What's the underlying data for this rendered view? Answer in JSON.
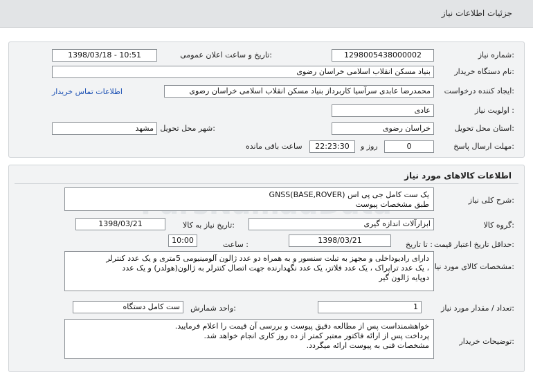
{
  "header": {
    "title": "جزئیات اطلاعات نیاز"
  },
  "need_info": {
    "need_number_label": "شماره نیاز:",
    "need_number": "1298005438000002",
    "announce_label": "تاریخ و ساعت اعلان عمومی:",
    "announce_value": "1398/03/18 - 10:51",
    "buyer_label": "نام دستگاه خریدار:",
    "buyer_value": "بنیاد مسکن انقلاب اسلامی خراسان رضوی",
    "creator_label": "ایجاد کننده درخواست:",
    "creator_value": "محمدرضا عابدی سرآسیا کاربرداز بنیاد مسکن انقلاب اسلامی خراسان رضوی",
    "contact_link": "اطلاعات تماس خریدار",
    "priority_label": "اولویت نیاز :",
    "priority_value": "عادی",
    "province_label": "استان محل تحویل:",
    "province_value": "خراسان رضوی",
    "city_label": "شهر محل تحویل:",
    "city_value": "مشهد",
    "deadline_label": "مهلت ارسال پاسخ:",
    "deadline_days": "0",
    "days_word": "روز و",
    "deadline_time": "22:23:30",
    "remaining_word": "ساعت باقی مانده"
  },
  "goods": {
    "section_title": "اطلاعات کالاهای مورد نیاز",
    "summary_label": "شرح کلی نیاز:",
    "summary_lines": [
      "یک ست کامل جی پی اس (BASE,ROVER)GNSS",
      "طبق مشخصات پیوست"
    ],
    "group_label": "گروه کالا:",
    "group_value": "ابزارآلات اندازه گیری",
    "need_date_label": "تاریخ نیاز به کالا:",
    "need_date_value": "1398/03/21",
    "validity_label": "حداقل تاریخ اعتبار قیمت:",
    "to_date_label": "تا تاریخ :",
    "to_date_value": "1398/03/21",
    "hour_label": "ساعت :",
    "hour_value": "10:00",
    "spec_label": "مشخصات کالای مورد نیاز:",
    "spec_lines": [
      "دارای رادیوداخلی و مجهز به تبلت سنسور و به همراه دو عدد ژالون آلومینیومی 5متری  و یک عدد کنترلر",
      "، یک  عدد تراپراک ، یک عدد فلاتز، یک عدد  نگهدارنده جهت اتصال کنترلر به ژالون(هولدر)  و یک عدد",
      "دوپایه ژالون گیر"
    ],
    "qty_label": "تعداد / مقدار مورد نیاز:",
    "qty_value": "1",
    "unit_label": "واحد شمارش:",
    "unit_value": "ست کامل دستگاه",
    "notes_label": "توضیحات خریدار:",
    "notes_lines": [
      "خواهشمنداست پس از مطالعه دقیق پیوست و بررسی آن قیمت را اعلام فرمایید.",
      "پرداخت پس از ارائه فاکتور معتبر کمتر از ده روز کاری انجام خواهد شد.",
      "مشخصات فنی به پیوست ارائه میگردد."
    ]
  },
  "watermark": {
    "brand": "ParsNamadData",
    "phone": "۰۲۱-۸۸۳۴۹۶۷۰-۵"
  }
}
